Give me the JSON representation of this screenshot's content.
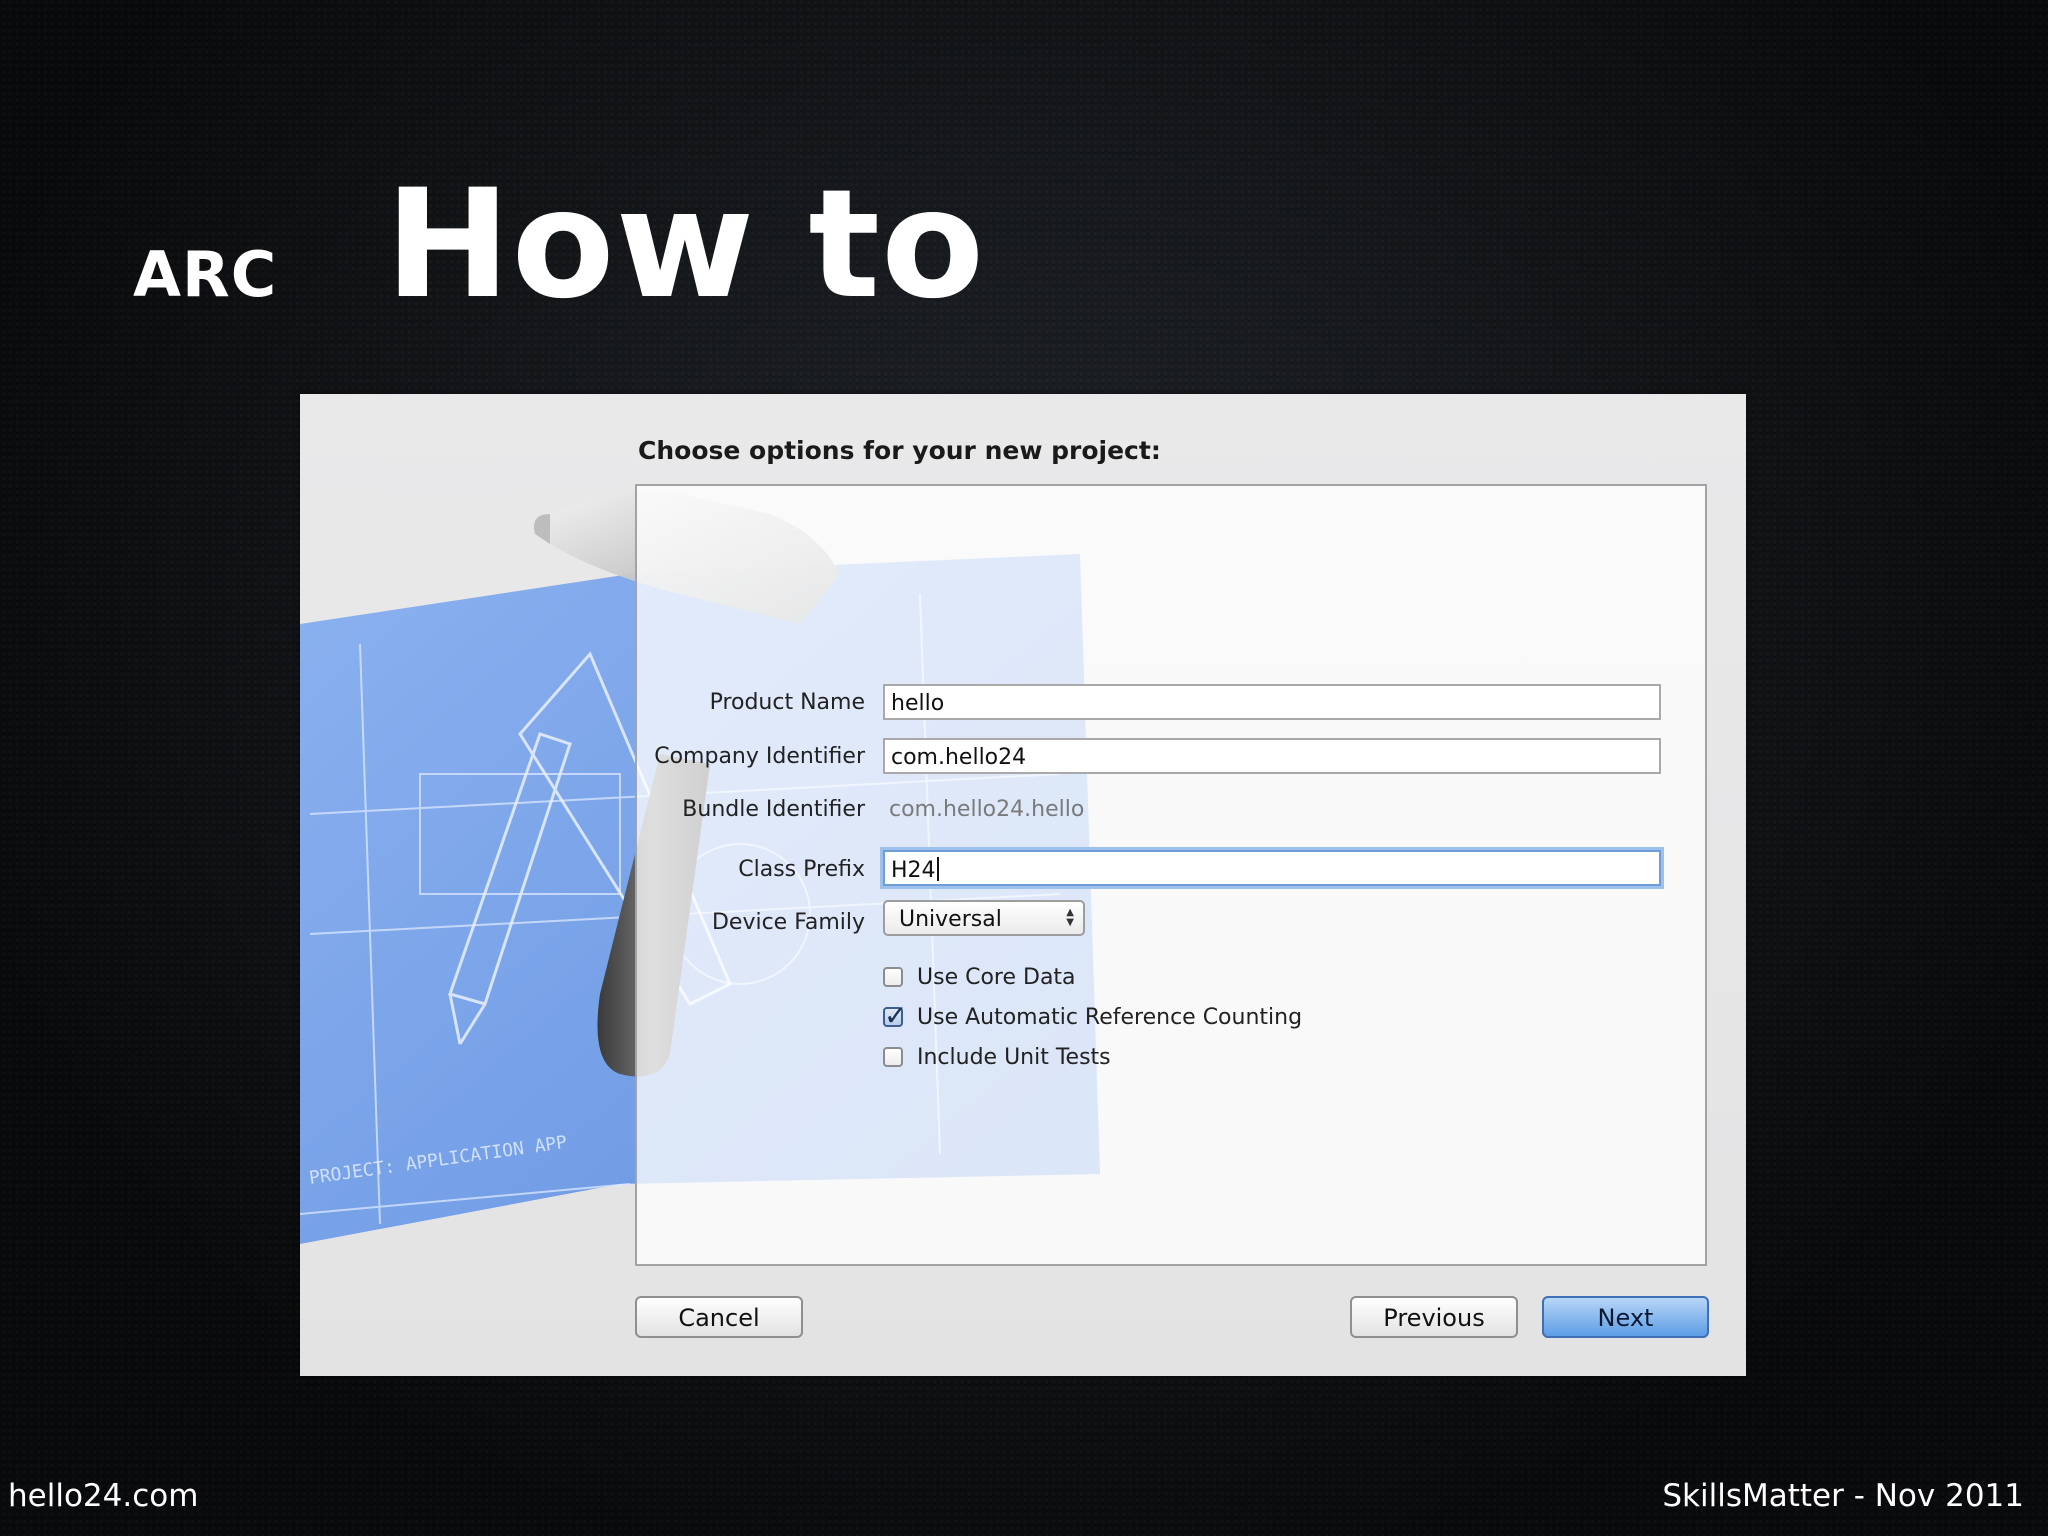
{
  "slide": {
    "section": "ARC",
    "title": "How to",
    "footer_left": "hello24.com",
    "footer_right": "SkillsMatter - Nov 2011"
  },
  "dialog": {
    "heading": "Choose options for your new project:",
    "fields": {
      "product_name": {
        "label": "Product Name",
        "value": "hello"
      },
      "company_identifier": {
        "label": "Company Identifier",
        "value": "com.hello24"
      },
      "bundle_identifier": {
        "label": "Bundle Identifier",
        "value": "com.hello24.hello"
      },
      "class_prefix": {
        "label": "Class Prefix",
        "value": "H24"
      },
      "device_family": {
        "label": "Device Family",
        "value": "Universal"
      }
    },
    "checkboxes": {
      "core_data": {
        "label": "Use Core Data",
        "checked": false
      },
      "arc": {
        "label": "Use Automatic Reference Counting",
        "checked": true
      },
      "unit_tests": {
        "label": "Include Unit Tests",
        "checked": false
      }
    },
    "buttons": {
      "cancel": "Cancel",
      "previous": "Previous",
      "next": "Next"
    },
    "artwork_text": "PROJECT: APPLICATION APP"
  },
  "colors": {
    "background": "#101317",
    "dialog": "#e6e6e7",
    "blueprint": "#6e9be8",
    "focus_ring": "#9ec1ec",
    "default_button": "#5d9de6"
  }
}
